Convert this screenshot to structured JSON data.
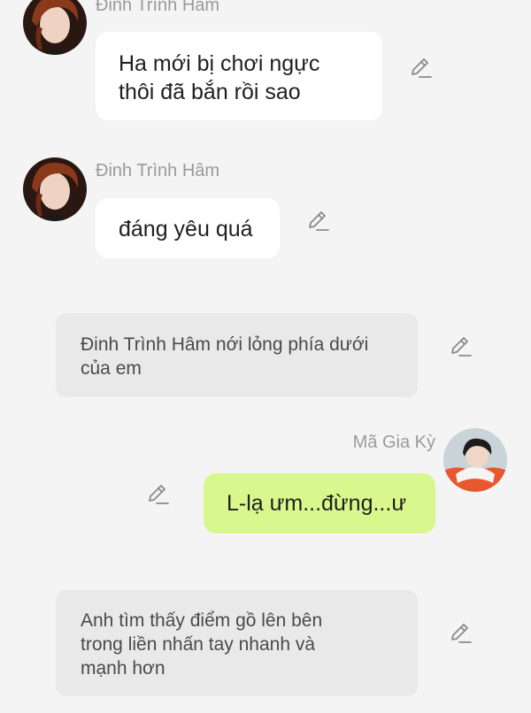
{
  "colors": {
    "background": "#f4f4f4",
    "bubble_incoming": "#ffffff",
    "bubble_outgoing": "#d8f78c",
    "narration_background": "#e9e9e9",
    "name_text": "#9a9a9a",
    "icon": "#8a8a8a"
  },
  "messages": [
    {
      "type": "incoming",
      "sender": "Đinh Trình Hâm",
      "avatar_icon": "avatar-dinh-trinh-ham",
      "lines": [
        "Ha mới bị chơi ngực",
        "thôi đã bắn rồi sao"
      ],
      "action_icon": "edit-pencil-icon"
    },
    {
      "type": "incoming",
      "sender": "Đinh Trình Hâm",
      "avatar_icon": "avatar-dinh-trinh-ham",
      "lines": [
        "đáng yêu quá"
      ],
      "action_icon": "edit-pencil-icon"
    },
    {
      "type": "narration",
      "lines": [
        "Đinh Trình Hâm nới lỏng phía dưới",
        "của em"
      ],
      "action_icon": "edit-pencil-icon"
    },
    {
      "type": "outgoing",
      "sender": "Mã Gia Kỳ",
      "avatar_icon": "avatar-ma-gia-ky",
      "lines": [
        "L-lạ ưm...đừng...ư"
      ],
      "action_icon": "edit-pencil-icon"
    },
    {
      "type": "narration",
      "lines": [
        "Anh tìm thấy điểm gồ lên bên",
        "trong liền nhấn tay nhanh và",
        "mạnh hơn"
      ],
      "action_icon": "edit-pencil-icon"
    }
  ]
}
